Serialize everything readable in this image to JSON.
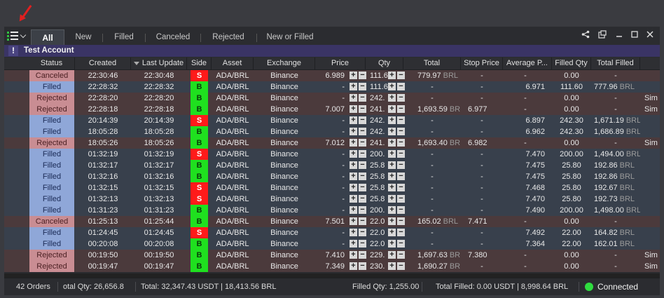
{
  "tabs": [
    {
      "label": "All",
      "active": true
    },
    {
      "label": "New",
      "active": false
    },
    {
      "label": "Filled",
      "active": false
    },
    {
      "label": "Canceled",
      "active": false
    },
    {
      "label": "Rejected",
      "active": false
    },
    {
      "label": "New or Filled",
      "active": false
    }
  ],
  "account": {
    "name": "Test Account",
    "icon": "!"
  },
  "columns": [
    "Status",
    "Created",
    "Last Update",
    "Side",
    "Asset",
    "Exchange",
    "Price",
    "Qty",
    "Total",
    "Stop Price",
    "Average P...",
    "Filled Qty",
    "Total Filled"
  ],
  "qty_buttons": {
    "plus": "+",
    "minus": "−"
  },
  "rows": [
    {
      "status": "Canceled",
      "created": "22:30:46",
      "updated": "22:30:48",
      "side": "S",
      "asset": "ADA/BRL",
      "exchange": "Binance",
      "price": "6.989",
      "qty": "111.6",
      "total": "779.97",
      "total_unit": "BRL",
      "stop": "-",
      "avg": "-",
      "filled": "0.00",
      "tfilled": "-",
      "tfilled_unit": "",
      "extra": ""
    },
    {
      "status": "Filled",
      "created": "22:28:32",
      "updated": "22:28:32",
      "side": "B",
      "asset": "ADA/BRL",
      "exchange": "Binance",
      "price": "-",
      "qty": "111.6",
      "total": "-",
      "total_unit": "",
      "stop": "-",
      "avg": "6.971",
      "filled": "111.60",
      "tfilled": "777.96",
      "tfilled_unit": "BRL",
      "extra": ""
    },
    {
      "status": "Rejected",
      "created": "22:28:20",
      "updated": "22:28:20",
      "side": "B",
      "asset": "ADA/BRL",
      "exchange": "Binance",
      "price": "-",
      "qty": "242.",
      "total": "-",
      "total_unit": "",
      "stop": "-",
      "avg": "-",
      "filled": "0.00",
      "tfilled": "-",
      "tfilled_unit": "",
      "extra": "Sim"
    },
    {
      "status": "Rejected",
      "created": "22:28:18",
      "updated": "22:28:18",
      "side": "B",
      "asset": "ADA/BRL",
      "exchange": "Binance",
      "price": "7.007",
      "qty": "241.",
      "total": "1,693.59",
      "total_unit": "BRL",
      "stop": "6.977",
      "avg": "-",
      "filled": "0.00",
      "tfilled": "-",
      "tfilled_unit": "",
      "extra": "Sim"
    },
    {
      "status": "Filled",
      "created": "20:14:39",
      "updated": "20:14:39",
      "side": "S",
      "asset": "ADA/BRL",
      "exchange": "Binance",
      "price": "-",
      "qty": "242.",
      "total": "-",
      "total_unit": "",
      "stop": "-",
      "avg": "6.897",
      "filled": "242.30",
      "tfilled": "1,671.19",
      "tfilled_unit": "BRL",
      "extra": ""
    },
    {
      "status": "Filled",
      "created": "18:05:28",
      "updated": "18:05:28",
      "side": "B",
      "asset": "ADA/BRL",
      "exchange": "Binance",
      "price": "-",
      "qty": "242.",
      "total": "-",
      "total_unit": "",
      "stop": "-",
      "avg": "6.962",
      "filled": "242.30",
      "tfilled": "1,686.89",
      "tfilled_unit": "BRL",
      "extra": ""
    },
    {
      "status": "Rejected",
      "created": "18:05:26",
      "updated": "18:05:26",
      "side": "B",
      "asset": "ADA/BRL",
      "exchange": "Binance",
      "price": "7.012",
      "qty": "241.",
      "total": "1,693.40",
      "total_unit": "BRL",
      "stop": "6.982",
      "avg": "-",
      "filled": "0.00",
      "tfilled": "-",
      "tfilled_unit": "",
      "extra": "Sim"
    },
    {
      "status": "Filled",
      "created": "01:32:19",
      "updated": "01:32:19",
      "side": "S",
      "asset": "ADA/BRL",
      "exchange": "Binance",
      "price": "-",
      "qty": "200.",
      "total": "-",
      "total_unit": "",
      "stop": "-",
      "avg": "7.470",
      "filled": "200.00",
      "tfilled": "1,494.00",
      "tfilled_unit": "BRL",
      "extra": ""
    },
    {
      "status": "Filled",
      "created": "01:32:17",
      "updated": "01:32:17",
      "side": "B",
      "asset": "ADA/BRL",
      "exchange": "Binance",
      "price": "-",
      "qty": "25.8",
      "total": "-",
      "total_unit": "",
      "stop": "-",
      "avg": "7.475",
      "filled": "25.80",
      "tfilled": "192.86",
      "tfilled_unit": "BRL",
      "extra": ""
    },
    {
      "status": "Filled",
      "created": "01:32:16",
      "updated": "01:32:16",
      "side": "B",
      "asset": "ADA/BRL",
      "exchange": "Binance",
      "price": "-",
      "qty": "25.8",
      "total": "-",
      "total_unit": "",
      "stop": "-",
      "avg": "7.475",
      "filled": "25.80",
      "tfilled": "192.86",
      "tfilled_unit": "BRL",
      "extra": ""
    },
    {
      "status": "Filled",
      "created": "01:32:15",
      "updated": "01:32:15",
      "side": "S",
      "asset": "ADA/BRL",
      "exchange": "Binance",
      "price": "-",
      "qty": "25.8",
      "total": "-",
      "total_unit": "",
      "stop": "-",
      "avg": "7.468",
      "filled": "25.80",
      "tfilled": "192.67",
      "tfilled_unit": "BRL",
      "extra": ""
    },
    {
      "status": "Filled",
      "created": "01:32:13",
      "updated": "01:32:13",
      "side": "S",
      "asset": "ADA/BRL",
      "exchange": "Binance",
      "price": "-",
      "qty": "25.8",
      "total": "-",
      "total_unit": "",
      "stop": "-",
      "avg": "7.470",
      "filled": "25.80",
      "tfilled": "192.73",
      "tfilled_unit": "BRL",
      "extra": ""
    },
    {
      "status": "Filled",
      "created": "01:31:23",
      "updated": "01:31:23",
      "side": "B",
      "asset": "ADA/BRL",
      "exchange": "Binance",
      "price": "-",
      "qty": "200.",
      "total": "-",
      "total_unit": "",
      "stop": "-",
      "avg": "7.490",
      "filled": "200.00",
      "tfilled": "1,498.00",
      "tfilled_unit": "BRL",
      "extra": ""
    },
    {
      "status": "Canceled",
      "created": "01:25:13",
      "updated": "01:25:44",
      "side": "B",
      "asset": "ADA/BRL",
      "exchange": "Binance",
      "price": "7.501",
      "qty": "22.0",
      "total": "165.02",
      "total_unit": "BRL",
      "stop": "7.471",
      "avg": "-",
      "filled": "0.00",
      "tfilled": "-",
      "tfilled_unit": "",
      "extra": ""
    },
    {
      "status": "Filled",
      "created": "01:24:45",
      "updated": "01:24:45",
      "side": "S",
      "asset": "ADA/BRL",
      "exchange": "Binance",
      "price": "-",
      "qty": "22.0",
      "total": "-",
      "total_unit": "",
      "stop": "-",
      "avg": "7.492",
      "filled": "22.00",
      "tfilled": "164.82",
      "tfilled_unit": "BRL",
      "extra": ""
    },
    {
      "status": "Filled",
      "created": "00:20:08",
      "updated": "00:20:08",
      "side": "B",
      "asset": "ADA/BRL",
      "exchange": "Binance",
      "price": "-",
      "qty": "22.0",
      "total": "-",
      "total_unit": "",
      "stop": "-",
      "avg": "7.364",
      "filled": "22.00",
      "tfilled": "162.01",
      "tfilled_unit": "BRL",
      "extra": ""
    },
    {
      "status": "Rejected",
      "created": "00:19:50",
      "updated": "00:19:50",
      "side": "B",
      "asset": "ADA/BRL",
      "exchange": "Binance",
      "price": "7.410",
      "qty": "229.",
      "total": "1,697.63",
      "total_unit": "BRL",
      "stop": "7.380",
      "avg": "-",
      "filled": "0.00",
      "tfilled": "-",
      "tfilled_unit": "",
      "extra": "Sim"
    },
    {
      "status": "Rejected",
      "created": "00:19:47",
      "updated": "00:19:47",
      "side": "B",
      "asset": "ADA/BRL",
      "exchange": "Binance",
      "price": "7.349",
      "qty": "230.",
      "total": "1,690.27",
      "total_unit": "BRL",
      "stop": "-",
      "avg": "-",
      "filled": "0.00",
      "tfilled": "-",
      "tfilled_unit": "",
      "extra": "Sim"
    }
  ],
  "status_bar": {
    "orders": "42 Orders",
    "total_qty": "otal Qty: 26,656.8",
    "total": "Total: 32,347.43 USDT | 18,413.56 BRL",
    "filled_qty": "Filled Qty: 1,255.00",
    "total_filled": "Total Filled: 0.00 USDT | 8,998.64 BRL",
    "connection": "Connected"
  },
  "colors": {
    "red_row": "#4b3a3c",
    "blue_row": "#38404c",
    "sell": "#ff1a1a",
    "buy": "#1fe01f",
    "connected": "#2fdc3f",
    "arrow": "#e02020"
  }
}
